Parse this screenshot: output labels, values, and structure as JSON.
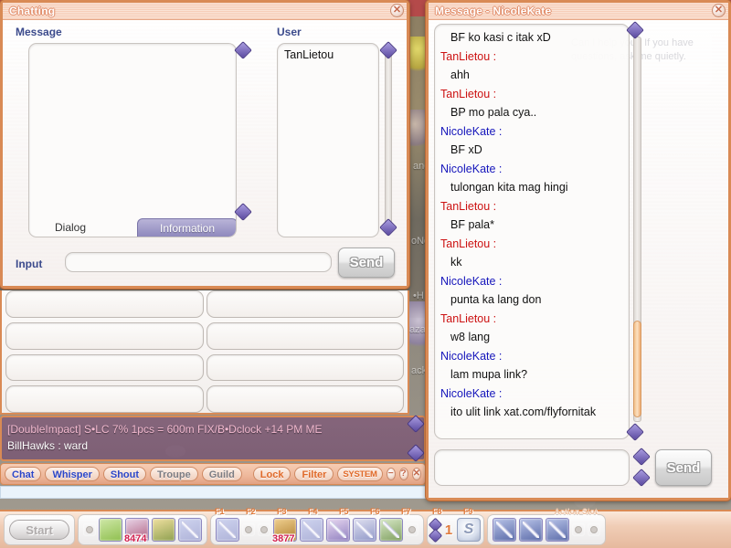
{
  "chatting_window": {
    "title": "Chatting",
    "close_icon": "close-icon",
    "message_label": "Message",
    "user_label": "User",
    "users": [
      "TanLietou"
    ],
    "tabs": [
      {
        "label": "Dialog",
        "active": false
      },
      {
        "label": "Information",
        "active": true
      }
    ],
    "input_label": "Input",
    "input_value": "",
    "input_placeholder": "",
    "send_label": "Send"
  },
  "message_window": {
    "title": "Message - NicoleKate",
    "close_icon": "close-icon",
    "messages": [
      {
        "sender": "",
        "text": "BF ko kasi c itak xD",
        "color": ""
      },
      {
        "sender": "TanLietou :",
        "text": "ahh",
        "color": "#cc1111"
      },
      {
        "sender": "TanLietou :",
        "text": "BP mo pala cya..",
        "color": "#cc1111"
      },
      {
        "sender": "NicoleKate :",
        "text": "BF xD",
        "color": "#1515bb"
      },
      {
        "sender": "NicoleKate :",
        "text": "tulongan kita mag hingi",
        "color": "#1515bb"
      },
      {
        "sender": "TanLietou :",
        "text": "BF pala*",
        "color": "#cc1111"
      },
      {
        "sender": "TanLietou :",
        "text": "kk",
        "color": "#cc1111"
      },
      {
        "sender": "NicoleKate :",
        "text": "punta ka lang don",
        "color": "#1515bb"
      },
      {
        "sender": "TanLietou :",
        "text": "w8 lang",
        "color": "#cc1111"
      },
      {
        "sender": "NicoleKate :",
        "text": "lam mupa link?",
        "color": "#1515bb"
      },
      {
        "sender": "NicoleKate :",
        "text": "ito ulit link xat.com/flyfornitak",
        "color": "#1515bb"
      }
    ],
    "input_value": "",
    "send_label": "Send"
  },
  "chat_log": {
    "line1": "[DoubleImpact] S•LC 7% 1pcs = 600m FIX/B•Dclock +14 PM ME",
    "line2": "BillHawks : ward"
  },
  "chat_toolbar": {
    "buttons": [
      {
        "label": "Chat",
        "style": "blue"
      },
      {
        "label": "Whisper",
        "style": "blue"
      },
      {
        "label": "Shout",
        "style": "blue"
      },
      {
        "label": "Troupe",
        "style": "gray"
      },
      {
        "label": "Guild",
        "style": "gray"
      },
      {
        "label": "Lock",
        "style": "orange"
      },
      {
        "label": "Filter",
        "style": "orange"
      },
      {
        "label": "SYSTEM",
        "style": "sys"
      }
    ],
    "icons": [
      "minimize-icon",
      "help-icon",
      "close-icon"
    ],
    "minimize_glyph": "−",
    "help_glyph": "?",
    "close_glyph": "✕"
  },
  "taskbar": {
    "start_label": "Start",
    "item_counts": {
      "slot2": "8474",
      "slot_f4": "3877"
    },
    "fkeys": [
      "F1",
      "F2",
      "F3",
      "F4",
      "F5",
      "F6",
      "F7",
      "F8",
      "F9"
    ],
    "action_slot_label": "Action Slot",
    "page_number": "1",
    "skill_icon_glyph": "S"
  },
  "game_background": {
    "ghost_texts": [
      "Can I help you? If you have questions, ask me quietly."
    ]
  },
  "colors": {
    "window_border": "#d98a55",
    "title_text": "#ffffff",
    "sender_red": "#cc1111",
    "sender_blue": "#1515bb",
    "label_blue": "#3b4a8c",
    "scroll_arrow": "#5b4aa0",
    "scroll_thumb": "#f3c089"
  }
}
